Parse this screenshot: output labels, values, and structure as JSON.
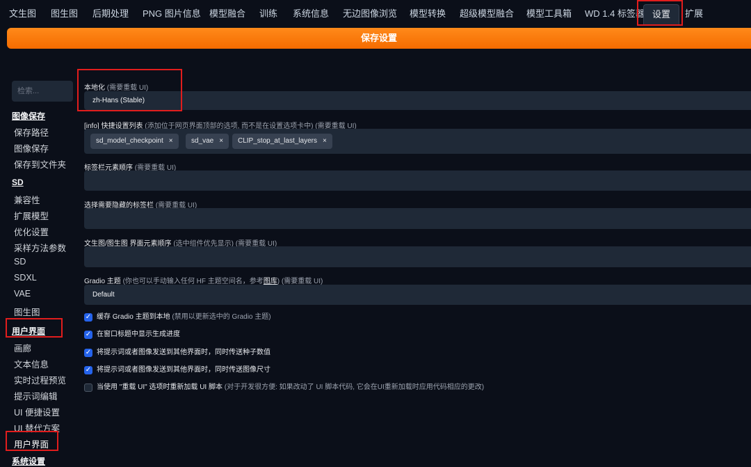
{
  "tabs": [
    {
      "label": "文生图"
    },
    {
      "label": "图生图"
    },
    {
      "label": "后期处理"
    },
    {
      "label": "PNG 图片信息"
    },
    {
      "label": "模型融合"
    },
    {
      "label": "训练"
    },
    {
      "label": "系统信息"
    },
    {
      "label": "无边图像浏览"
    },
    {
      "label": "模型转换"
    },
    {
      "label": "超级模型融合"
    },
    {
      "label": "模型工具箱"
    },
    {
      "label": "WD 1.4 标签器"
    },
    {
      "label": "设置"
    },
    {
      "label": "扩展"
    }
  ],
  "save_button": "保存设置",
  "sidebar": {
    "search_placeholder": "检索...",
    "sections": [
      {
        "title": "图像保存",
        "items": [
          "保存路径",
          "图像保存",
          "保存到文件夹"
        ]
      },
      {
        "title": "SD",
        "items": [
          "兼容性",
          "扩展模型",
          "优化设置",
          "采样方法参数",
          "SD",
          "SDXL",
          "VAE",
          "图生图"
        ]
      },
      {
        "title": "用户界面",
        "items": [
          "画廊",
          "文本信息",
          "实时过程预览",
          "提示词编辑",
          "UI 便捷设置",
          "UI 替代方案",
          "用户界面"
        ]
      }
    ],
    "cut_off_item": "系统设置"
  },
  "settings": {
    "localization": {
      "label": "本地化",
      "note": "(需要重载 UI)",
      "value": "zh-Hans (Stable)"
    },
    "quicksettings": {
      "info": "[info]",
      "label": "快捷设置列表",
      "note": "(添加位于网页界面顶部的选项, 而不是在设置选项卡中) (需要重载 UI)",
      "chips": [
        "sd_model_checkpoint",
        "sd_vae",
        "CLIP_stop_at_last_layers"
      ],
      "remove_symbol": "×"
    },
    "tab_order": {
      "label": "标签栏元素顺序",
      "note": "(需要重载 UI)"
    },
    "hidden_tabs": {
      "label": "选择需要隐藏的标签栏",
      "note": "(需要重载 UI)"
    },
    "ui_order": {
      "label": "文生图/图生图 界面元素顺序",
      "note": "(选中组件优先显示) (需要重载 UI)"
    },
    "gradio_theme": {
      "label": "Gradio 主题",
      "note_a": "(你也可以手动输入任何 HF 主题空间名，参考",
      "link": "图库",
      "note_b": ") (需要重载 UI)",
      "value": "Default"
    },
    "checkboxes": [
      {
        "label": "缓存 Gradio 主题到本地",
        "note": "(禁用以更新选中的 Gradio 主题)",
        "checked": true
      },
      {
        "label": "在窗口标题中显示生成进度",
        "note": "",
        "checked": true
      },
      {
        "label": "将提示词或者图像发送到其他界面时，同时传送种子数值",
        "note": "",
        "checked": true
      },
      {
        "label": "将提示词或者图像发送到其他界面时，同时传送图像尺寸",
        "note": "",
        "checked": true
      },
      {
        "label": "当使用 \"重载 UI\" 选项时重新加载 UI 脚本",
        "note": "(对于开发很方便: 如果改动了 UI 脚本代码, 它会在UI重新加载时应用代码相应的更改)",
        "checked": false
      }
    ],
    "checkmark": "✓"
  },
  "colors": {
    "accent": "#f97316",
    "highlight": "#e11d1d",
    "checkbox": "#2563eb",
    "background": "#0b0f19"
  }
}
